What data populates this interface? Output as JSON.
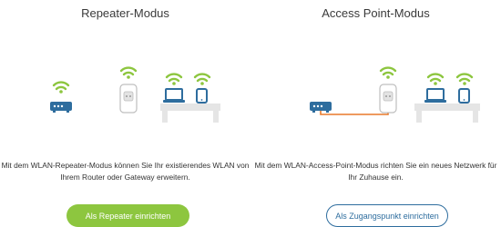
{
  "repeater": {
    "title": "Repeater-Modus",
    "description": "Mit dem WLAN-Repeater-Modus können Sie Ihr existierendes WLAN von Ihrem Router oder Gateway erweitern.",
    "button_label": "Als Repeater einrichten"
  },
  "access_point": {
    "title": "Access Point-Modus",
    "description": "Mit dem WLAN-Access-Point-Modus richten Sie ein neues Netzwerk für Ihr Zuhause ein.",
    "button_label": "Als Zugangspunkt einrichten"
  },
  "colors": {
    "wifi": "#8dc63f",
    "device_blue": "#2e6d9e",
    "cable": "#e8792a",
    "table": "#e5e5e5"
  },
  "icons": [
    "router-icon",
    "wifi-icon",
    "plug-repeater-icon",
    "laptop-icon",
    "tablet-icon",
    "table-icon",
    "ethernet-cable-icon"
  ]
}
